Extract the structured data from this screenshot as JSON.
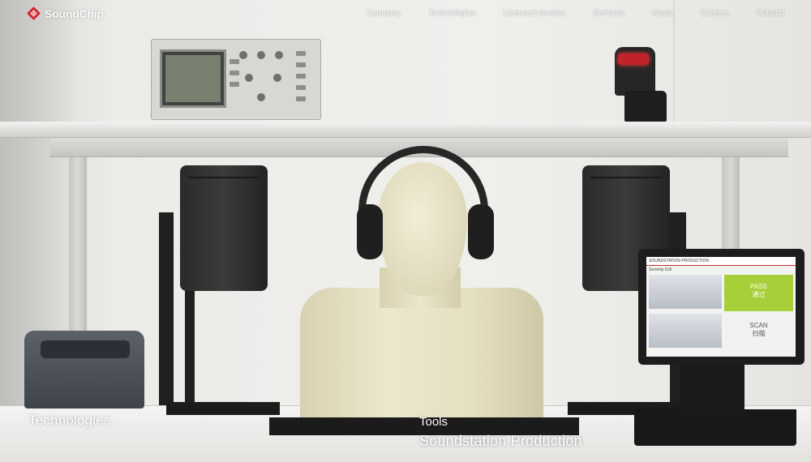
{
  "brand": {
    "name": "SoundChip",
    "logo_icon": "soundchip-logo-icon",
    "logo_color": "#d1232a"
  },
  "nav": {
    "items": [
      {
        "label": "Company"
      },
      {
        "label": "Technologies"
      },
      {
        "label": "Licensed devices"
      },
      {
        "label": "Services"
      },
      {
        "label": "News"
      },
      {
        "label": "Careers"
      },
      {
        "label": "Contact"
      }
    ]
  },
  "hero": {
    "left_caption": "Technologies",
    "right_tag": "Tools",
    "right_title": "Soundstation Production"
  },
  "monitor_screen": {
    "header_brand": "SOUNDSTATION PRODUCTION",
    "device": "Serenity 518",
    "pass_label": "PASS",
    "pass_sub": "通过",
    "scan_label": "SCAN",
    "scan_sub": "扫描",
    "pass_color": "#a6cf3a"
  }
}
